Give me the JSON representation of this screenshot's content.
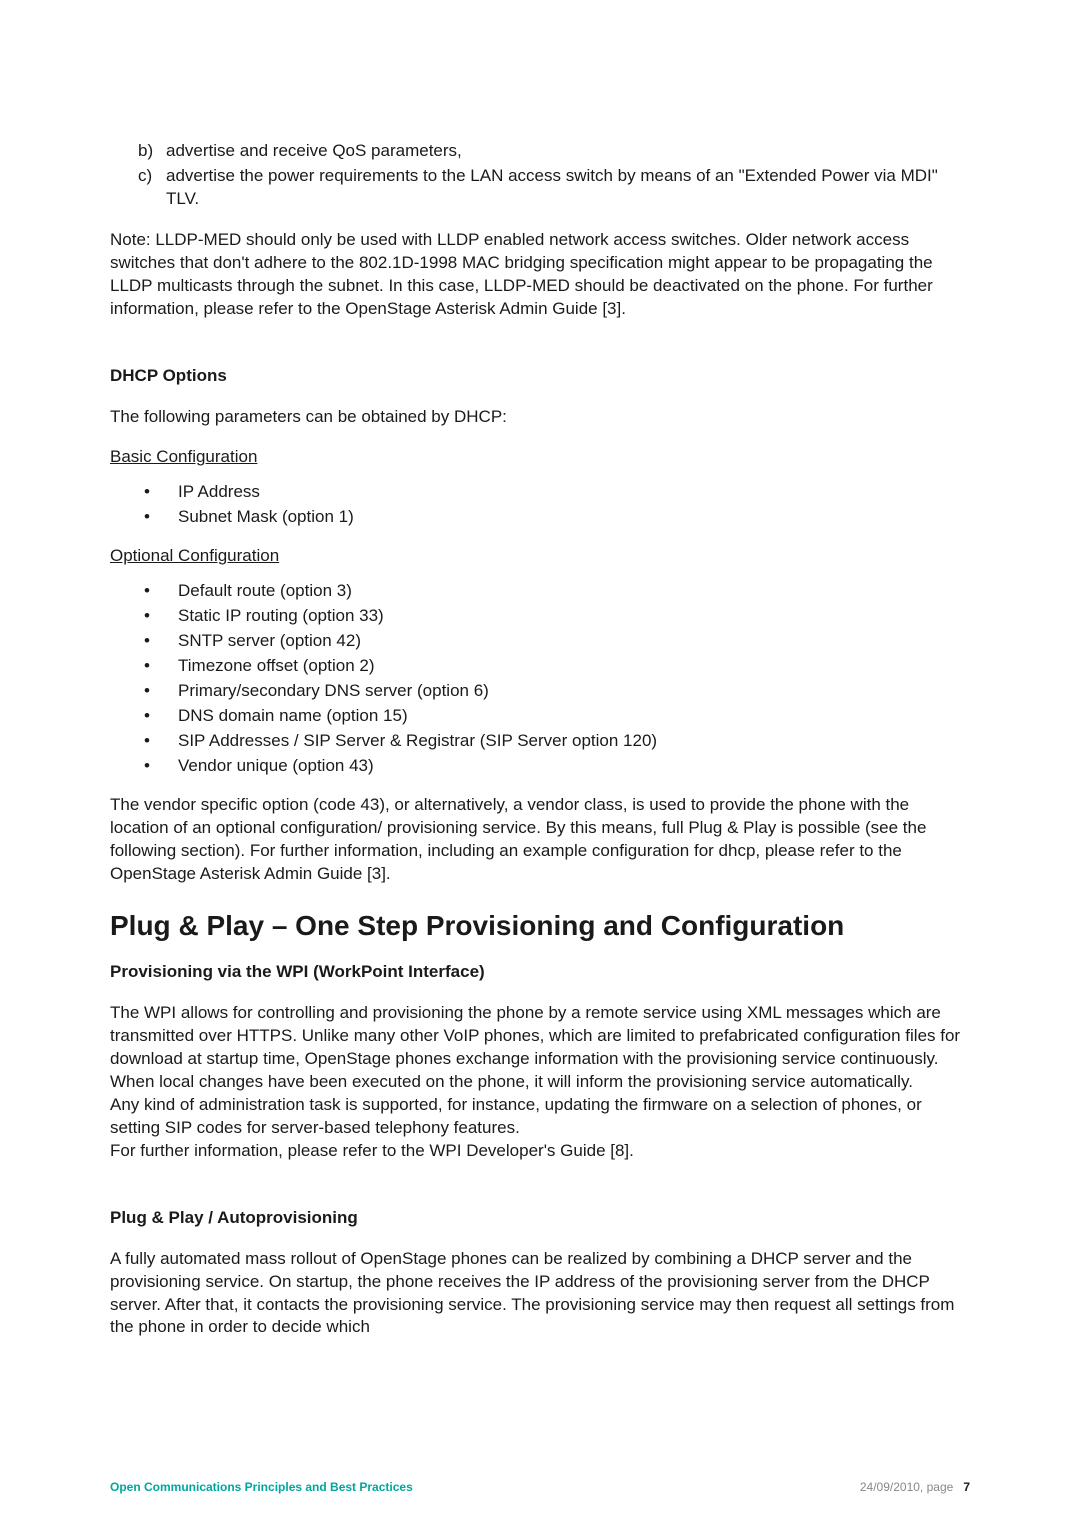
{
  "letters": {
    "b": "advertise and receive QoS parameters,",
    "c": "advertise the power requirements to the LAN access switch by means of an \"Extended Power via MDI\" TLV."
  },
  "note": "Note: LLDP-MED should only be used with LLDP enabled network access switches. Older network access switches that don't adhere to the 802.1D-1998 MAC bridging specification might appear to be propagating the LLDP multicasts through the subnet. In this case, LLDP-MED should be deactivated on the phone. For further information, please refer to the OpenStage Asterisk Admin Guide [3].",
  "dhcp": {
    "heading": "DHCP Options",
    "intro": "The following parameters can be obtained by DHCP:",
    "basic_label": "Basic Configuration",
    "basic_items": [
      "IP Address",
      "Subnet Mask (option 1)"
    ],
    "optional_label": "Optional Configuration",
    "optional_items": [
      "Default route (option 3)",
      "Static IP routing (option 33)",
      "SNTP server (option 42)",
      "Timezone offset (option 2)",
      "Primary/secondary DNS server (option 6)",
      "DNS domain name (option 15)",
      "SIP Addresses / SIP Server & Registrar (SIP Server option 120)",
      "Vendor unique (option 43)"
    ],
    "outro": "The vendor specific option (code 43), or alternatively, a vendor class, is used to provide the phone with the location of an optional configuration/ provisioning service. By this means, full Plug & Play is possible (see the following section). For further information, including an example configuration for dhcp, please refer to the OpenStage Asterisk Admin Guide [3]."
  },
  "plug": {
    "title": "Plug & Play – One Step Provisioning and Configuration",
    "wpi_heading": "Provisioning via the WPI (WorkPoint Interface)",
    "wpi_body": "The WPI allows for controlling and provisioning the phone by a remote service using XML messages which are transmitted over HTTPS. Unlike many other VoIP phones, which are limited to prefabricated configuration files for download at startup time, OpenStage phones exchange information with the provisioning service continuously. When local changes have been executed on the phone, it will inform the provisioning service automatically.\nAny kind of administration task is supported, for instance, updating the firmware on a selection of phones, or setting SIP codes for server-based telephony features.\nFor further information, please refer to the WPI Developer's Guide [8].",
    "auto_heading": "Plug & Play / Autoprovisioning",
    "auto_body": "A fully automated mass rollout of OpenStage phones can be realized by combining a DHCP server and the provisioning service. On startup, the phone receives the IP address of the provisioning server from the DHCP server. After that, it contacts the provisioning service. The provisioning service may then request all settings from the phone in order to decide which"
  },
  "footer": {
    "left": "Open Communications Principles and Best Practices",
    "date": "24/09/2010, page",
    "page": "7"
  }
}
